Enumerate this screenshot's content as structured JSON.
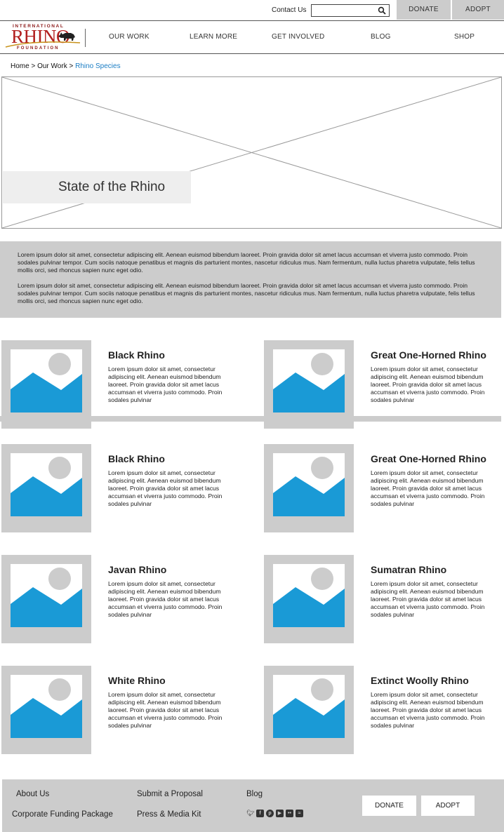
{
  "utility": {
    "contact_label": "Contact Us",
    "search_placeholder": "",
    "donate_label": "DONATE",
    "adopt_label": "ADOPT"
  },
  "logo": {
    "line1": "INTERNATIONAL",
    "line2": "RHINO",
    "line3": "FOUNDATION",
    "brand_color": "#b21f1f"
  },
  "nav": {
    "items": [
      "OUR WORK",
      "LEARN MORE",
      "GET INVOLVED",
      "BLOG",
      "SHOP"
    ]
  },
  "breadcrumb": {
    "home": "Home",
    "sep": ">",
    "section": "Our Work",
    "current": "Rhino Species"
  },
  "hero": {
    "caption": "State of the Rhino"
  },
  "intro": {
    "paragraphs": [
      "Lorem ipsum dolor sit amet, consectetur adipiscing elit. Aenean euismod bibendum laoreet. Proin gravida dolor sit amet lacus accumsan et viverra justo commodo. Proin sodales pulvinar tempor. Cum sociis natoque penatibus et magnis dis parturient montes, nascetur ridiculus mus. Nam fermentum, nulla luctus pharetra vulputate, felis tellus mollis orci, sed rhoncus sapien nunc eget odio.",
      "Lorem ipsum dolor sit amet, consectetur adipiscing elit. Aenean euismod bibendum laoreet. Proin gravida dolor sit amet lacus accumsan et viverra justo commodo. Proin sodales pulvinar tempor. Cum sociis natoque penatibus et magnis dis parturient montes, nascetur ridiculus mus. Nam fermentum, nulla luctus pharetra vulputate, felis tellus mollis orci, sed rhoncus sapien nunc eget odio."
    ]
  },
  "species": [
    {
      "name": "Black Rhino",
      "text": "Lorem ipsum dolor sit amet, consectetur adipiscing elit. Aenean euismod bibendum laoreet. Proin gravida dolor sit amet lacus accumsan et viverra justo commodo. Proin sodales pulvinar"
    },
    {
      "name": "Great One-Horned Rhino",
      "text": "Lorem ipsum dolor sit amet, consectetur adipiscing elit. Aenean euismod bibendum laoreet. Proin gravida dolor sit amet lacus accumsan et viverra justo commodo. Proin sodales pulvinar"
    },
    {
      "name": "Black Rhino",
      "text": "Lorem ipsum dolor sit amet, consectetur adipiscing elit. Aenean euismod bibendum laoreet. Proin gravida dolor sit amet lacus accumsan et viverra justo commodo. Proin sodales pulvinar"
    },
    {
      "name": "Great One-Horned Rhino",
      "text": "Lorem ipsum dolor sit amet, consectetur adipiscing elit. Aenean euismod bibendum laoreet. Proin gravida dolor sit amet lacus accumsan et viverra justo commodo. Proin sodales pulvinar"
    },
    {
      "name": "Javan Rhino",
      "text": "Lorem ipsum dolor sit amet, consectetur adipiscing elit. Aenean euismod bibendum laoreet. Proin gravida dolor sit amet lacus accumsan et viverra justo commodo. Proin sodales pulvinar"
    },
    {
      "name": "Sumatran Rhino",
      "text": "Lorem ipsum dolor sit amet, consectetur adipiscing elit. Aenean euismod bibendum laoreet. Proin gravida dolor sit amet lacus accumsan et viverra justo commodo. Proin sodales pulvinar"
    },
    {
      "name": "White Rhino",
      "text": "Lorem ipsum dolor sit amet, consectetur adipiscing elit. Aenean euismod bibendum laoreet. Proin gravida dolor sit amet lacus accumsan et viverra justo commodo. Proin sodales pulvinar"
    },
    {
      "name": "Extinct Woolly Rhino",
      "text": "Lorem ipsum dolor sit amet, consectetur adipiscing elit. Aenean euismod bibendum laoreet. Proin gravida dolor sit amet lacus accumsan et viverra justo commodo. Proin sodales pulvinar"
    }
  ],
  "footer": {
    "about": "About Us",
    "corporate": "Corporate Funding Package",
    "proposal": "Submit a Proposal",
    "press": "Press & Media Kit",
    "blog": "Blog",
    "donate_label": "DONATE",
    "adopt_label": "ADOPT",
    "social_icons": [
      "twitter-icon",
      "facebook-icon",
      "pinterest-icon",
      "youtube-icon",
      "flickr-icon",
      "rss-icon"
    ]
  },
  "colors": {
    "placeholder_gray": "#cccccc",
    "image_blue": "#1a9ad6",
    "link_blue": "#1a7dc4"
  }
}
